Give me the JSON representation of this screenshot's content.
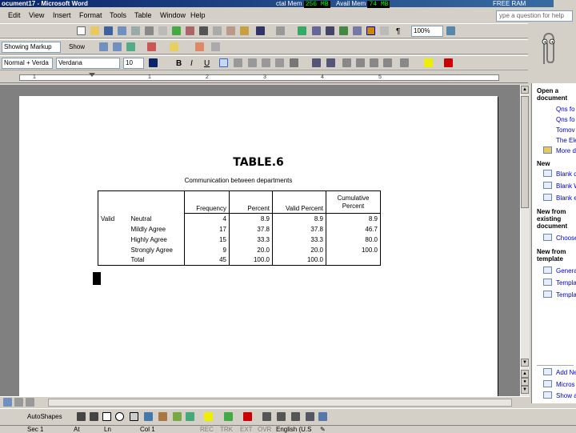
{
  "window": {
    "title": "ocument17 - Microsoft Word",
    "total_mem_label": "ctal Mem",
    "total_mem_value": "256 MB",
    "avail_mem_label": "Avail Mem",
    "avail_mem_value": "74 MB",
    "free_ram_label": "FREE RAM"
  },
  "menu": [
    "Edit",
    "View",
    "Insert",
    "Format",
    "Tools",
    "Table",
    "Window",
    "Help"
  ],
  "help_box": {
    "placeholder": "ype a question for help"
  },
  "toolbar": {
    "zoom": "100%",
    "showing_markup": "Showing Markup",
    "show": "Show",
    "style": "Normal + Verda",
    "font": "Verdana",
    "font_size": "10"
  },
  "ruler_numbers": [
    "1",
    "1",
    "2",
    "3",
    "4",
    "5"
  ],
  "task_pane": {
    "open_header": "Open a document",
    "open_items": [
      "Qns fo",
      "Qns fo",
      "Tomov",
      "The Ele",
      "More d"
    ],
    "new_header": "New",
    "new_items": [
      "Blank d",
      "Blank W",
      "Blank e"
    ],
    "existing_header": "New from existing document",
    "existing_items": [
      "Choose"
    ],
    "template_header": "New from template",
    "template_items": [
      "Genera",
      "Templa",
      "Templa"
    ],
    "bottom_items": [
      "Add Ne",
      "Micros",
      "Show a"
    ]
  },
  "document": {
    "title": "TABLE.6",
    "caption": "Communication between departments",
    "headers": [
      "Frequency",
      "Percent",
      "Valid Percent",
      "Cumulative Percent"
    ],
    "row_group": "Valid",
    "rows": [
      {
        "label": "Neutral",
        "frequency": "4",
        "percent": "8.9",
        "valid_percent": "8.9",
        "cumulative": "8.9"
      },
      {
        "label": "Mildly Agree",
        "frequency": "17",
        "percent": "37.8",
        "valid_percent": "37.8",
        "cumulative": "46.7"
      },
      {
        "label": "Highly Agree",
        "frequency": "15",
        "percent": "33.3",
        "valid_percent": "33.3",
        "cumulative": "80.0"
      },
      {
        "label": "Strongly Agree",
        "frequency": "9",
        "percent": "20.0",
        "valid_percent": "20.0",
        "cumulative": "100.0"
      },
      {
        "label": "Total",
        "frequency": "45",
        "percent": "100.0",
        "valid_percent": "100.0",
        "cumulative": ""
      }
    ]
  },
  "drawing_toolbar": {
    "autoshapes": "AutoShapes"
  },
  "status_bar": {
    "page": "Sec 1",
    "at": "At",
    "ln": "Ln",
    "col": "Col 1",
    "rec": "REC",
    "trk": "TRK",
    "ext": "EXT",
    "ovr": "OVR",
    "language": "English (U.S"
  }
}
